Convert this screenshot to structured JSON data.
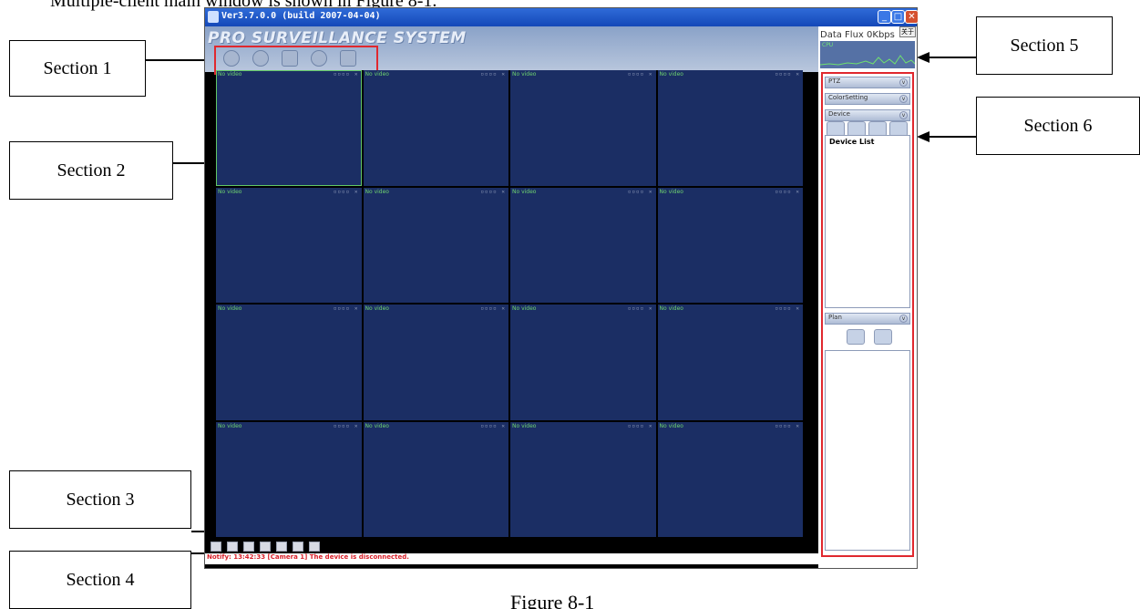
{
  "doc": {
    "intro_text": "Multiple-client main window is shown in Figure 8-1.",
    "caption": "Figure 8-1"
  },
  "callouts": [
    {
      "label": "Section 1"
    },
    {
      "label": "Section 2"
    },
    {
      "label": "Section 3"
    },
    {
      "label": "Section 4"
    },
    {
      "label": "Section 5"
    },
    {
      "label": "Section 6"
    }
  ],
  "app": {
    "window_title": "Ver3.7.0.0 (build 2007-04-04)",
    "brand": "PRO SURVEILLANCE SYSTEM",
    "toolbar_icons": [
      "record-icon",
      "search-icon",
      "playback-icon",
      "config-icon",
      "monitor-icon"
    ],
    "video_cells": [
      "No video",
      "No video",
      "No video",
      "No video",
      "No video",
      "No video",
      "No video",
      "No video",
      "No video",
      "No video",
      "No video",
      "No video",
      "No video",
      "No video",
      "No video",
      "No video"
    ],
    "notify": "Notify: 13:42:33 [Camera 1] The device is disconnected.",
    "side": {
      "data_flux": "Data Flux  0Kbps",
      "lang_button": "关于",
      "cpu_label": "CPU",
      "ptz_label": "PTZ",
      "color_label": "ColorSetting",
      "device_label": "Device",
      "device_list": "Device List",
      "plan_label": "Plan"
    },
    "colors": {
      "accent": "#e0282e",
      "cell_bg": "#1b2e64",
      "notify_text": "#d8202a"
    }
  }
}
